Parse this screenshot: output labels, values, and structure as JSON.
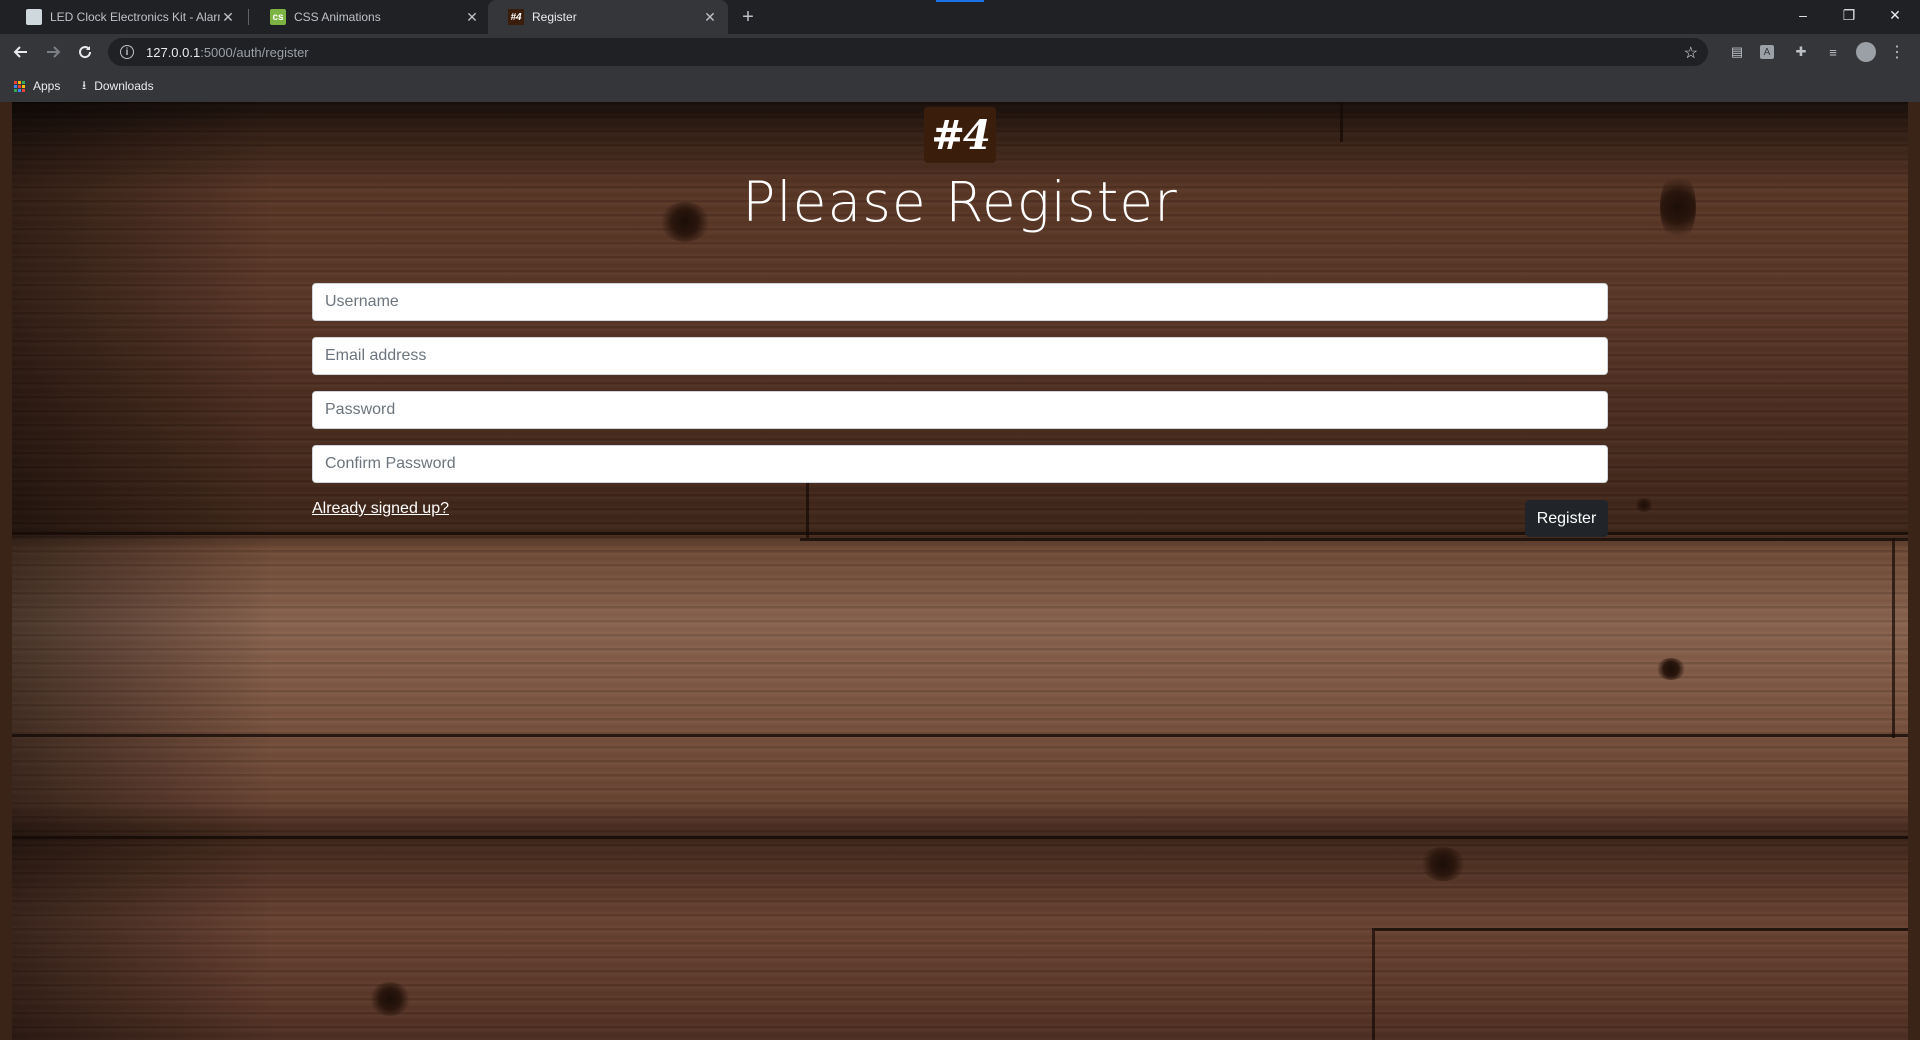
{
  "browser": {
    "tabs": [
      {
        "title": "LED Clock Electronics Kit - Alarm",
        "favicon": "doc-icon",
        "active": false
      },
      {
        "title": "CSS Animations",
        "favicon": "css-icon",
        "active": false
      },
      {
        "title": "Register",
        "favicon": "#4",
        "active": true
      }
    ],
    "new_tab_label": "+",
    "window_controls": {
      "minimize": "–",
      "restore": "❐",
      "close": "✕"
    },
    "address": {
      "host": "127.0.0.1",
      "path": ":5000/auth/register"
    },
    "bookmarks": [
      {
        "label": "Apps",
        "icon": "apps-grid-icon"
      },
      {
        "label": "Downloads",
        "icon": "download-icon"
      }
    ]
  },
  "page": {
    "logo_text": "#4",
    "heading": "Please Register",
    "fields": {
      "username_placeholder": "Username",
      "email_placeholder": "Email address",
      "password_placeholder": "Password",
      "confirm_placeholder": "Confirm Password"
    },
    "signin_link": "Already signed up?",
    "register_button": "Register"
  },
  "colors": {
    "button_bg": "#212529",
    "logo_bg": "#3b1d0c",
    "browser_chrome": "#35363a"
  }
}
